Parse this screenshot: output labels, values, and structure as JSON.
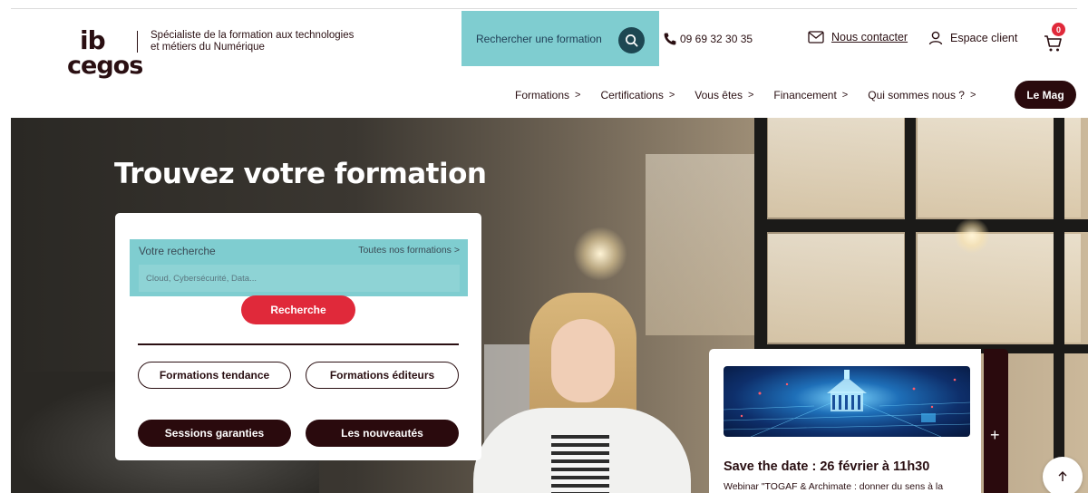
{
  "brand": {
    "logo_top": "ib",
    "logo_bottom": "cegos",
    "tagline_line1": "Spécialiste de la formation aux technologies",
    "tagline_line2": "et métiers du Numérique"
  },
  "header": {
    "search_placeholder": "Rechercher une formation",
    "phone": "09 69 32 30 35",
    "contact_label": "Nous contacter",
    "account_label": "Espace client",
    "cart_count": "0"
  },
  "nav": {
    "items": [
      {
        "label": "Formations",
        "chevron": ">"
      },
      {
        "label": "Certifications",
        "chevron": ">"
      },
      {
        "label": "Vous êtes",
        "chevron": ">"
      },
      {
        "label": "Financement",
        "chevron": ">"
      },
      {
        "label": "Qui sommes nous ?",
        "chevron": ">"
      }
    ],
    "mag_label": "Le Mag"
  },
  "hero": {
    "title": "Trouvez votre formation"
  },
  "search_card": {
    "label": "Votre recherche",
    "all_link": "Toutes nos formations >",
    "input_placeholder": "Cloud, Cybersécurité, Data...",
    "search_button": "Recherche",
    "buttons": {
      "trending": "Formations tendance",
      "publishers": "Formations éditeurs",
      "guaranteed": "Sessions garanties",
      "new": "Les nouveautés"
    }
  },
  "event": {
    "title": "Save the date : 26 février à 11h30",
    "description": "Webinar \"TOGAF & Archimate : donner du sens à la",
    "expand": "+"
  },
  "colors": {
    "brand_dark": "#2a0a0d",
    "accent_red": "#e0293a",
    "highlight_teal": "#7fcdd0",
    "search_button": "#1d4752"
  },
  "icons": {
    "search": "search-icon",
    "phone": "phone-icon",
    "mail": "mail-icon",
    "user": "user-icon",
    "cart": "cart-icon",
    "arrow_up": "arrow-up-icon"
  }
}
